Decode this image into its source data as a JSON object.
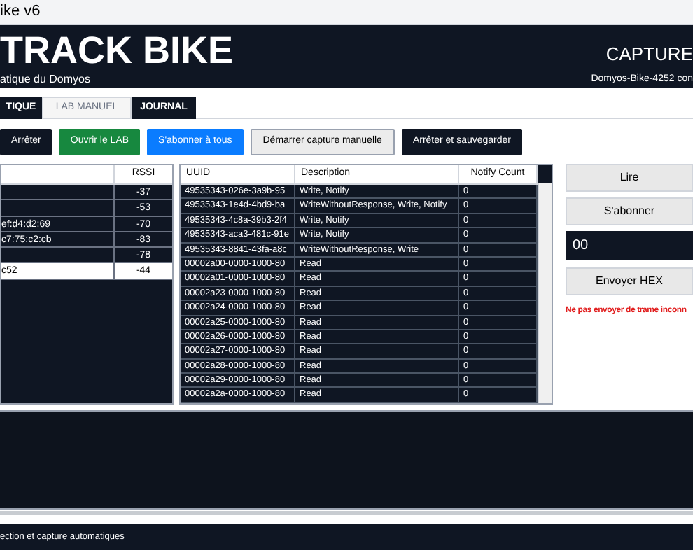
{
  "window": {
    "title": "ike v6"
  },
  "header": {
    "title": "TRACK BIKE",
    "subtitle": "atique du Domyos",
    "status_title": "CAPTURE",
    "status_detail": "Domyos-Bike-4252 con"
  },
  "tabs": [
    {
      "label": "TIQUE",
      "selected": false
    },
    {
      "label": "LAB MANUEL",
      "selected": true
    },
    {
      "label": "JOURNAL",
      "selected": false
    }
  ],
  "toolbar": [
    {
      "label": "Arrêter",
      "kind": "dark"
    },
    {
      "label": "Ouvrir le LAB",
      "kind": "green"
    },
    {
      "label": "S'abonner à tous",
      "kind": "blue"
    },
    {
      "label": "Démarrer capture manuelle",
      "kind": "light"
    },
    {
      "label": "Arrêter et sauvegarder",
      "kind": "dark"
    }
  ],
  "devices": {
    "columns": [
      "RSSI"
    ],
    "rows": [
      {
        "name": "",
        "rssi": "-37",
        "selected": false
      },
      {
        "name": "",
        "rssi": "-53",
        "selected": false
      },
      {
        "name": "ef:d4:d2:69",
        "rssi": "-70",
        "selected": false
      },
      {
        "name": "c7:75:c2:cb",
        "rssi": "-83",
        "selected": false
      },
      {
        "name": "",
        "rssi": "-78",
        "selected": false
      },
      {
        "name": "c52",
        "rssi": "-44",
        "selected": true
      }
    ]
  },
  "characteristics": {
    "columns": [
      "UUID",
      "Description",
      "Notify Count"
    ],
    "rows": [
      [
        "49535343-026e-3a9b-95",
        "Write, Notify",
        "0"
      ],
      [
        "49535343-1e4d-4bd9-ba",
        "WriteWithoutResponse, Write, Notify",
        "0"
      ],
      [
        "49535343-4c8a-39b3-2f4",
        "Write, Notify",
        "0"
      ],
      [
        "49535343-aca3-481c-91e",
        "Write, Notify",
        "0"
      ],
      [
        "49535343-8841-43fa-a8c",
        "WriteWithoutResponse, Write",
        "0"
      ],
      [
        "00002a00-0000-1000-80",
        "Read",
        "0"
      ],
      [
        "00002a01-0000-1000-80",
        "Read",
        "0"
      ],
      [
        "00002a23-0000-1000-80",
        "Read",
        "0"
      ],
      [
        "00002a24-0000-1000-80",
        "Read",
        "0"
      ],
      [
        "00002a25-0000-1000-80",
        "Read",
        "0"
      ],
      [
        "00002a26-0000-1000-80",
        "Read",
        "0"
      ],
      [
        "00002a27-0000-1000-80",
        "Read",
        "0"
      ],
      [
        "00002a28-0000-1000-80",
        "Read",
        "0"
      ],
      [
        "00002a29-0000-1000-80",
        "Read",
        "0"
      ],
      [
        "00002a2a-0000-1000-80",
        "Read",
        "0"
      ]
    ]
  },
  "side_panel": {
    "read_button": "Lire",
    "subscribe_button": "S'abonner",
    "hex_field": {
      "value": "00"
    },
    "send_button": "Envoyer HEX",
    "warning": "Ne pas envoyer de trame inconn"
  },
  "status_bar": "ection et capture automatiques"
}
